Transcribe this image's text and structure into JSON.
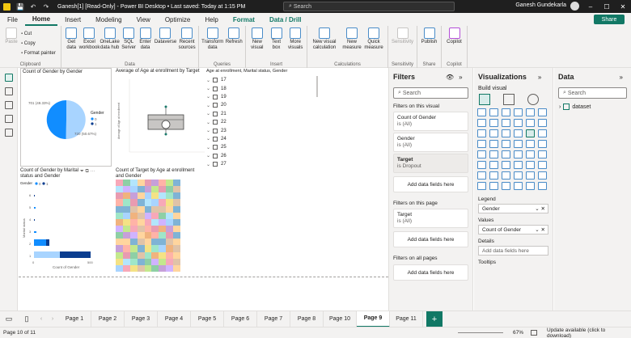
{
  "titlebar": {
    "title": "Ganesh[1] [Read-Only] - Power BI Desktop • Last saved: Today at 1:15 PM",
    "search_placeholder": "Search",
    "user": "Ganesh Gundekarla"
  },
  "menu": {
    "tabs": [
      "File",
      "Home",
      "Insert",
      "Modeling",
      "View",
      "Optimize",
      "Help",
      "Format",
      "Data / Drill"
    ],
    "share": "Share"
  },
  "ribbon": {
    "clipboard": {
      "paste": "Paste",
      "cut": "Cut",
      "copy": "Copy",
      "format_painter": "Format painter",
      "group": "Clipboard"
    },
    "data": {
      "items": [
        "Get data",
        "Excel workbook",
        "OneLake data hub",
        "SQL Server",
        "Enter data",
        "Dataverse",
        "Recent sources"
      ],
      "group": "Data"
    },
    "queries": {
      "items": [
        "Transform data",
        "Refresh"
      ],
      "group": "Queries"
    },
    "insert": {
      "items": [
        "New visual",
        "Text box",
        "More visuals"
      ],
      "group": "Insert"
    },
    "calculations": {
      "items": [
        "New visual calculation",
        "New measure",
        "Quick measure"
      ],
      "group": "Calculations"
    },
    "sensitivity": {
      "items": [
        "Sensitivity"
      ],
      "group": "Sensitivity"
    },
    "share": {
      "items": [
        "Publish"
      ],
      "group": "Share"
    },
    "copilot": {
      "items": [
        "Copilot"
      ],
      "group": "Copilot"
    }
  },
  "canvas": {
    "pie": {
      "title": "Count of Gender by Gender",
      "legend_title": "Gender",
      "legend": [
        "0",
        "1"
      ],
      "label_a": "701 (49.33%)",
      "label_b": "720 (50.67%)",
      "colors": [
        "#118dff",
        "#a8d4ff"
      ]
    },
    "boxplot": {
      "title": "Average of Age at enrollment by Target",
      "ylabel": "Average of Age at enrollment"
    },
    "slicer": {
      "title": "Age at enrollment, Marital status, Gender",
      "items": [
        "17",
        "18",
        "19",
        "20",
        "21",
        "22",
        "23",
        "24",
        "25",
        "26",
        "27"
      ]
    },
    "bar": {
      "title": "Count of Gender by Marital status and Gender",
      "legend_title": "Gender",
      "legend": [
        "0",
        "1"
      ],
      "ylabel": "Marital status",
      "xlabel": "Count of Gender",
      "yticks": [
        "6",
        "5",
        "4",
        "3",
        "2",
        "1"
      ],
      "xticks": [
        "0",
        "500"
      ]
    },
    "heatmap": {
      "title": "Count of Target by Age at enrollment and Gender"
    }
  },
  "filters": {
    "title": "Filters",
    "search": "Search",
    "on_visual": "Filters on this visual",
    "cards_visual": [
      {
        "name": "Count of Gender",
        "value": "is (All)"
      },
      {
        "name": "Gender",
        "value": "is (All)"
      },
      {
        "name": "Target",
        "value": "is Dropout"
      }
    ],
    "add": "Add data fields here",
    "on_page": "Filters on this page",
    "cards_page": [
      {
        "name": "Target",
        "value": "is (All)"
      }
    ],
    "on_all": "Filters on all pages"
  },
  "viz": {
    "title": "Visualizations",
    "build": "Build visual",
    "legend": "Legend",
    "legend_field": "Gender",
    "values": "Values",
    "values_field": "Count of Gender",
    "details": "Details",
    "add": "Add data fields here",
    "tooltips": "Tooltips"
  },
  "data": {
    "title": "Data",
    "search": "Search",
    "table": "dataset"
  },
  "pages": [
    "Page 1",
    "Page 2",
    "Page 3",
    "Page 4",
    "Page 5",
    "Page 6",
    "Page 7",
    "Page 8",
    "Page 10",
    "Page 9",
    "Page 11"
  ],
  "active_page": "Page 9",
  "status": {
    "page": "Page 10 of 11",
    "zoom": "67%",
    "update": "Update available (click to download)"
  }
}
